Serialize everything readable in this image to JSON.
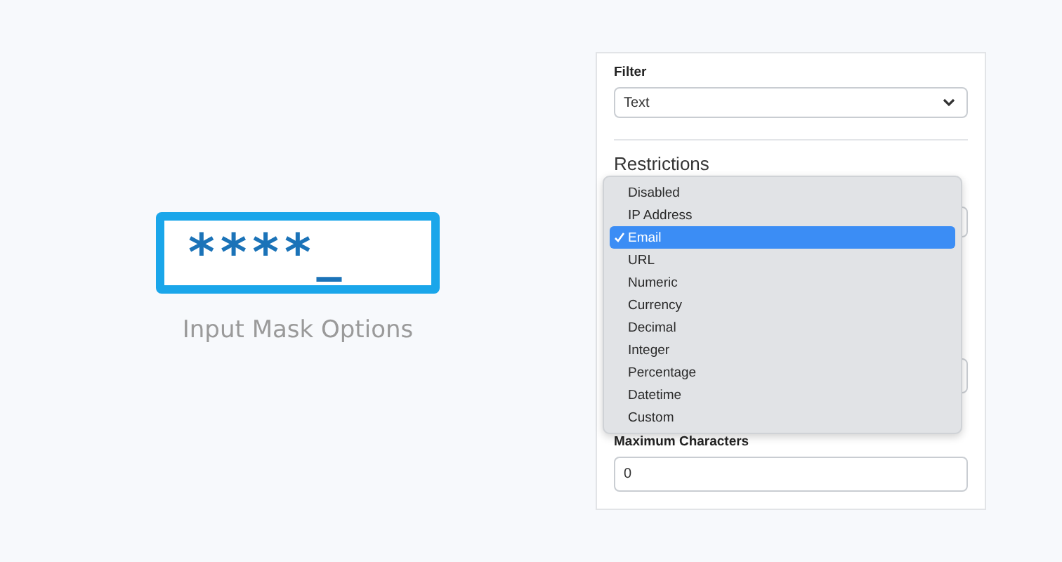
{
  "logo": {
    "mask": "****_",
    "caption": "Input Mask Options"
  },
  "filter": {
    "label": "Filter",
    "value": "Text"
  },
  "restrictions": {
    "heading": "Restrictions"
  },
  "dropdown": {
    "options": [
      {
        "label": "Disabled",
        "selected": false
      },
      {
        "label": "IP Address",
        "selected": false
      },
      {
        "label": "Email",
        "selected": true
      },
      {
        "label": "URL",
        "selected": false
      },
      {
        "label": "Numeric",
        "selected": false
      },
      {
        "label": "Currency",
        "selected": false
      },
      {
        "label": "Decimal",
        "selected": false
      },
      {
        "label": "Integer",
        "selected": false
      },
      {
        "label": "Percentage",
        "selected": false
      },
      {
        "label": "Datetime",
        "selected": false
      },
      {
        "label": "Custom",
        "selected": false
      }
    ]
  },
  "max_characters": {
    "label": "Maximum Characters",
    "value": "0"
  }
}
